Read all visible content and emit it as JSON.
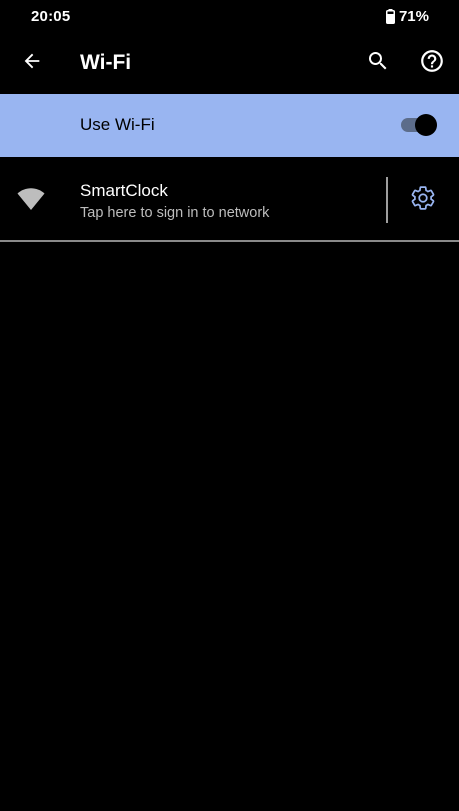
{
  "status_bar": {
    "time": "20:05",
    "battery_percent": "71%",
    "battery_icon": "battery-icon"
  },
  "app_bar": {
    "title": "Wi-Fi",
    "back_icon": "arrow-back-icon",
    "search_icon": "search-icon",
    "help_icon": "help-icon"
  },
  "use_wifi": {
    "label": "Use Wi-Fi",
    "enabled": true,
    "row_color": "#99b5f1"
  },
  "networks": [
    {
      "name": "SmartClock",
      "status": "Tap here to sign in to network",
      "signal_icon": "wifi-signal-icon",
      "settings_icon": "gear-icon",
      "settings_icon_color": "#99b5f1"
    }
  ]
}
